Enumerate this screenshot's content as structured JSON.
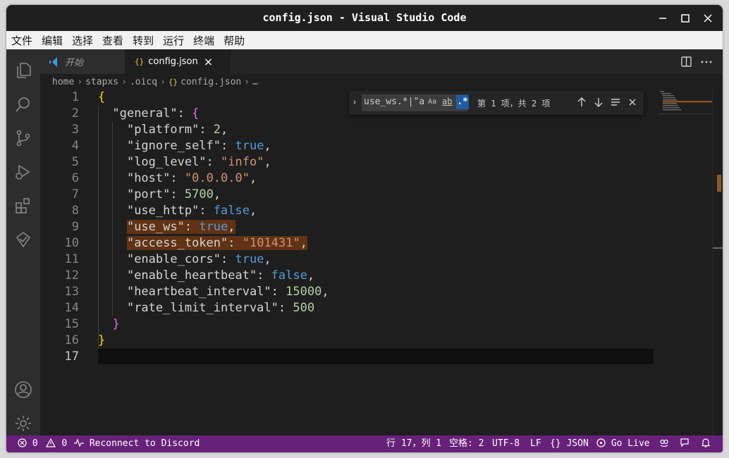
{
  "window": {
    "title": "config.json - Visual Studio Code"
  },
  "menu": [
    "文件",
    "编辑",
    "选择",
    "查看",
    "转到",
    "运行",
    "终端",
    "帮助"
  ],
  "tabs": [
    {
      "label": "开始",
      "icon": "vscode-logo-icon"
    },
    {
      "label": "config.json",
      "icon": "json-braces-icon",
      "close": "×"
    }
  ],
  "breadcrumb": {
    "parts": [
      "home",
      "stapxs",
      ".oicq"
    ],
    "file_icon": "{}",
    "file": "config.json",
    "trail": "…"
  },
  "editor": {
    "line_numbers": [
      "1",
      "2",
      "3",
      "4",
      "5",
      "6",
      "7",
      "8",
      "9",
      "10",
      "11",
      "12",
      "13",
      "14",
      "15",
      "16",
      "17"
    ],
    "current_line": 17
  },
  "find": {
    "query": "use_ws.*|\"a",
    "case_label": "Aa",
    "word_label": "ab",
    "regex_label": ".*",
    "result": "第 1 项，共 2 项"
  },
  "status": {
    "errors": "0",
    "warnings": "0",
    "discord": "Reconnect to Discord",
    "position": "行 17，列 1",
    "spaces": "空格: 2",
    "encoding": "UTF-8",
    "eol": "LF",
    "language": "{} JSON",
    "golive": "Go Live"
  },
  "colors": {
    "status_bg": "#68217a",
    "editor_bg": "#1e1e1e",
    "highlight": "#613214"
  }
}
